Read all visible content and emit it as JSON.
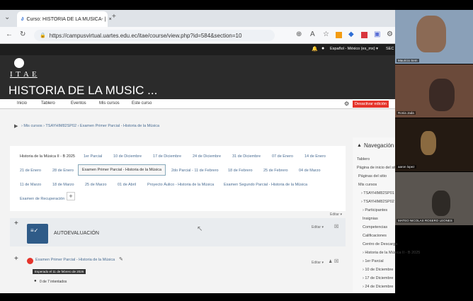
{
  "browser": {
    "tab_title": "Curso: HISTORIA DE LA MUSICA- |",
    "tab_close": "×",
    "new_tab": "+",
    "url": "https://campusvirtual.uartes.edu.ec/itae/course/view.php?id=584&section=10"
  },
  "moodle": {
    "language": "Español - México (es_mx) ▾",
    "user_short": "SEC",
    "logo_text": "I T A E",
    "course_title": "HISTORIA DE LA MUSIC ...",
    "nav_items": [
      "Inicio",
      "Tablero",
      "Eventos",
      "Mis cursos",
      "Este curso"
    ],
    "edit_button": "Desactivar edición",
    "breadcrumb": "› Mis cursos › TSAYHIM82SP02 › Examen Primer Parcial - Historia de la Música",
    "tabs_row1": [
      "Historia de la Música II - B 2025",
      "1er Parcial",
      "10 de Diciembre",
      "17 de Diciembre",
      "24 de Diciembre",
      "31 de Diciembre",
      "07 de Enero",
      "14 de Enero"
    ],
    "tabs_row2": [
      "21 de Enero",
      "28 de Enero",
      "Examen Primer Parcial - Historia de la Música",
      "2do Parcial - 11 de Febrero",
      "18 de Febrero",
      "25 de Febrero",
      "04 de Marzo"
    ],
    "tabs_row3": [
      "11 de Marzo",
      "18 de Marzo",
      "25 de Marzo",
      "01 de Abril",
      "Proyecto Áulico - Historia de la Música",
      "Examen Segundo Parcial - Historia de la Música"
    ],
    "tabs_row4": [
      "Examen de Recuperación"
    ],
    "add_tab": "+",
    "edit_link": "Editar ▾",
    "section_edit": "Editar ▾",
    "autoeval": "AUTOEVALUACIÓN",
    "plus": "+",
    "activity_title": "Examen Primer Parcial - Historia de la Música",
    "activity_edit": "Editar ▾",
    "expected": "Esperado el 11 de febrero de 2026",
    "attempts": "0 de 7 intentados"
  },
  "sidebar": {
    "title": "Navegación",
    "items": [
      "Tablero",
      "Página de inicio del sitio",
      "Páginas del sitio",
      "Mis cursos",
      "› TSAYHIM82SP01",
      "› TSAYHIM82SP02",
      "› Participantes",
      "Insignias",
      "Competencias",
      "Calificaciones",
      "Centro de Descarga",
      "› Historia de la Música II - B 2025",
      "› 1er Parcial",
      "› 10 de Diciembre",
      "› 17 de Diciembre",
      "› 24 de Diciembre"
    ]
  },
  "participants": [
    {
      "name": "Mauricio Sem"
    },
    {
      "name": "Ronia Jada"
    },
    {
      "name": "aaron lopez"
    },
    {
      "name": "MATEO NICOLAS ROSERO LEONES"
    }
  ],
  "colors": {
    "header": "#2b2b2b",
    "accent": "#e5342b",
    "link": "#4a6d93"
  }
}
